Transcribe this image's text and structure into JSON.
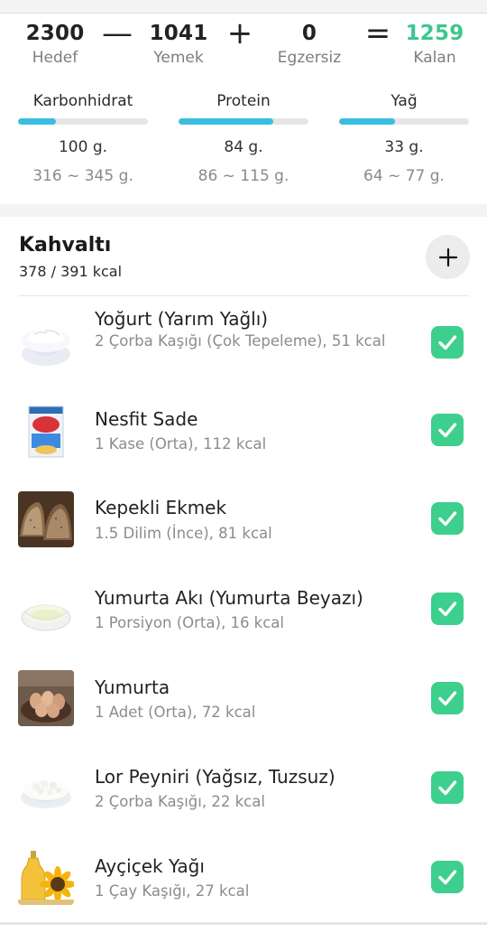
{
  "summary": {
    "goal": {
      "value": "2300",
      "label": "Hedef"
    },
    "op_minus": "—",
    "food": {
      "value": "1041",
      "label": "Yemek"
    },
    "op_plus": "+",
    "exercise": {
      "value": "0",
      "label": "Egzersiz"
    },
    "op_equals": "=",
    "remaining": {
      "value": "1259",
      "label": "Kalan"
    }
  },
  "colors": {
    "accent_green": "#3cc78f",
    "bar_blue": "#3bbde0",
    "check_green": "#3dcf8d"
  },
  "macros": [
    {
      "name": "Karbonhidrat",
      "progress": 0.29,
      "value": "100 g.",
      "range": "316 ~ 345 g."
    },
    {
      "name": "Protein",
      "progress": 0.73,
      "value": "84 g.",
      "range": "86 ~ 115 g."
    },
    {
      "name": "Yağ",
      "progress": 0.43,
      "value": "33 g.",
      "range": "64 ~ 77 g."
    }
  ],
  "meal": {
    "title": "Kahvaltı",
    "kcal": "378 / 391 kcal",
    "add_icon": "plus-icon",
    "items": [
      {
        "name": "Yoğurt (Yarım Yağlı)",
        "desc": "2 Çorba Kaşığı (Çok Tepeleme), 51 kcal",
        "icon": "yogurt-image",
        "checked": true
      },
      {
        "name": "Nesfit Sade",
        "desc": "1 Kase (Orta), 112 kcal",
        "icon": "cereal-box-image",
        "checked": true
      },
      {
        "name": "Kepekli Ekmek",
        "desc": "1.5 Dilim (İnce), 81 kcal",
        "icon": "bread-image",
        "checked": true
      },
      {
        "name": "Yumurta Akı (Yumurta Beyazı)",
        "desc": "1 Porsiyon (Orta), 16 kcal",
        "icon": "egg-white-image",
        "checked": true
      },
      {
        "name": "Yumurta",
        "desc": "1 Adet (Orta), 72 kcal",
        "icon": "eggs-image",
        "checked": true
      },
      {
        "name": "Lor Peyniri (Yağsız, Tuzsuz)",
        "desc": "2 Çorba Kaşığı, 22 kcal",
        "icon": "cottage-cheese-image",
        "checked": true
      },
      {
        "name": "Ayçiçek Yağı",
        "desc": "1 Çay Kaşığı, 27 kcal",
        "icon": "sunflower-oil-image",
        "checked": true
      }
    ]
  }
}
